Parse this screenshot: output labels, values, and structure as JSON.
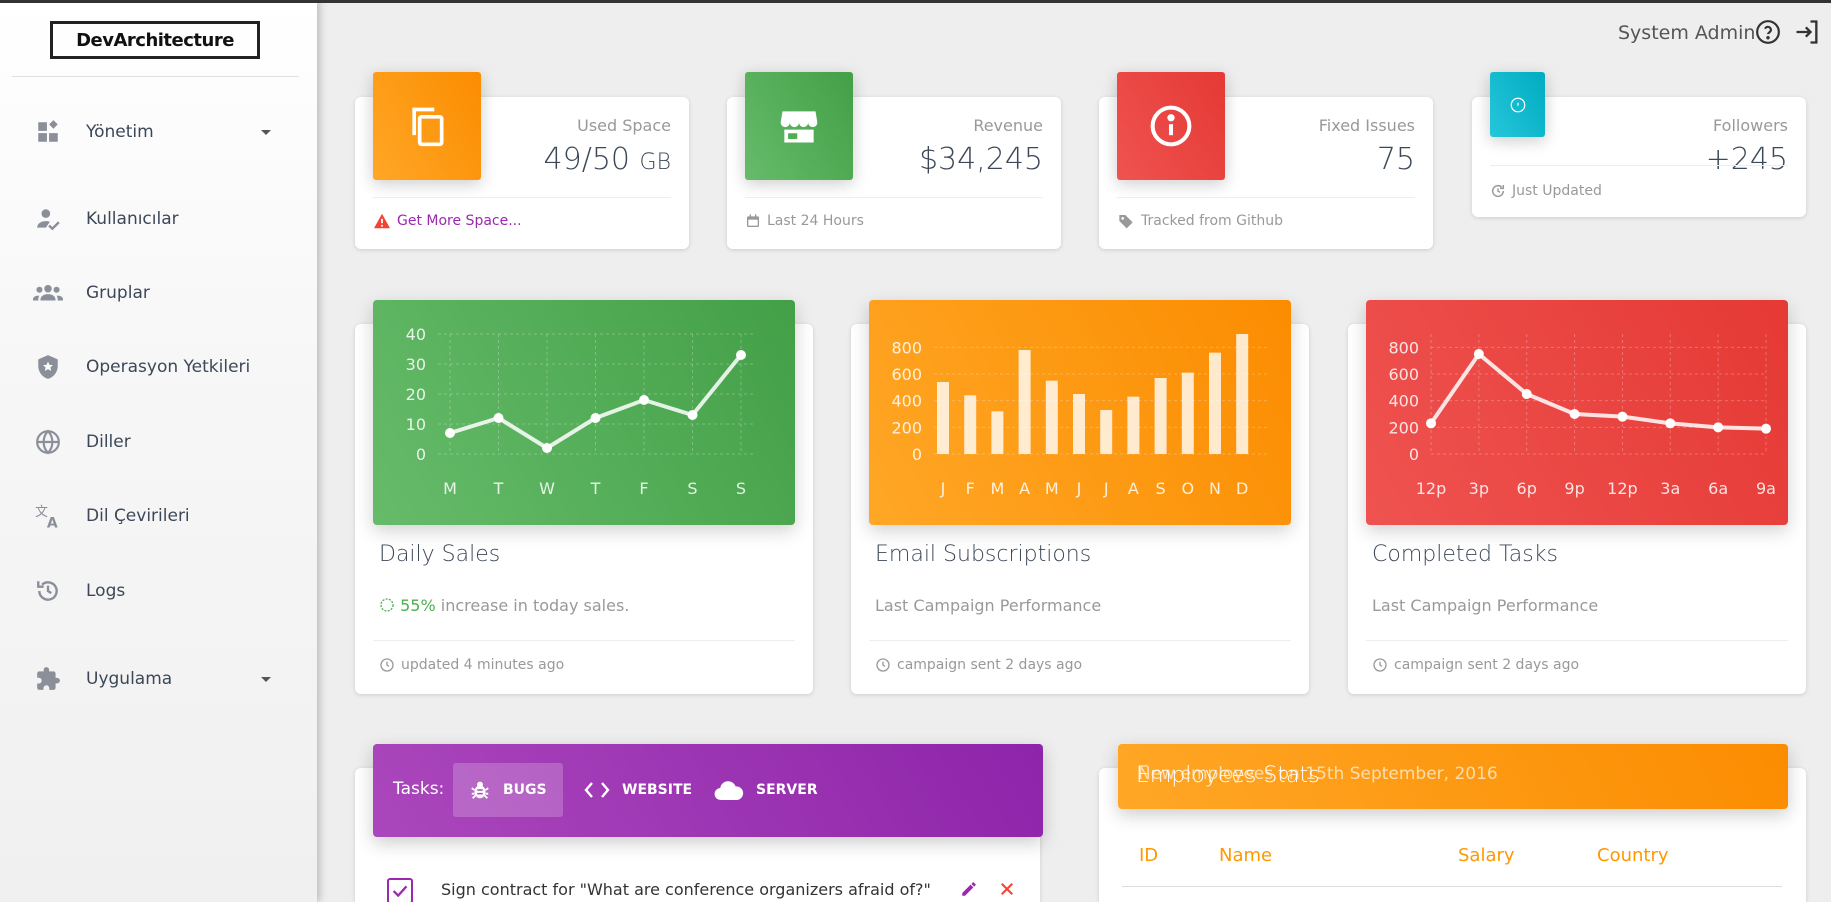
{
  "app": {
    "logo": "DevArchitecture"
  },
  "header": {
    "user_name": "System Admin",
    "help_icon": "help-circle-icon",
    "logout_icon": "logout-icon"
  },
  "sidebar": {
    "items": [
      {
        "label": "Yönetim",
        "icon": "dashboard-icon",
        "has_caret": true
      },
      {
        "label": "Kullanıcılar",
        "icon": "user-check-icon"
      },
      {
        "label": "Gruplar",
        "icon": "group-icon"
      },
      {
        "label": "Operasyon Yetkileri",
        "icon": "shield-star-icon"
      },
      {
        "label": "Diller",
        "icon": "globe-icon"
      },
      {
        "label": "Dil Çevirileri",
        "icon": "translate-icon"
      },
      {
        "label": "Logs",
        "icon": "history-icon"
      },
      {
        "label": "Uygulama",
        "icon": "puzzle-icon",
        "has_caret": true
      }
    ]
  },
  "stats": [
    {
      "category": "Used Space",
      "value": "49/50",
      "unit": "GB",
      "footer": "Get More Space...",
      "icon": "copy-icon",
      "footer_icon": "warning-icon",
      "color": "#fb8c00"
    },
    {
      "category": "Revenue",
      "value": "$34,245",
      "footer": "Last 24 Hours",
      "icon": "store-icon",
      "footer_icon": "calendar-icon",
      "color": "#43a047"
    },
    {
      "category": "Fixed Issues",
      "value": "75",
      "footer": "Tracked from Github",
      "icon": "info-icon",
      "footer_icon": "tag-icon",
      "color": "#e53935"
    },
    {
      "category": "Followers",
      "value": "+245",
      "footer": "Just Updated",
      "icon": "twitter-icon",
      "footer_icon": "update-icon",
      "color": "#00acc1"
    }
  ],
  "charts": [
    {
      "title": "Daily Sales",
      "subtitle_pct": "55%",
      "subtitle_rest": " increase in today sales.",
      "footer": "updated 4 minutes ago",
      "color": "#4caf50"
    },
    {
      "title": "Email Subscriptions",
      "subtitle": "Last Campaign Performance",
      "footer": "campaign sent 2 days ago",
      "color": "#ff9800"
    },
    {
      "title": "Completed Tasks",
      "subtitle": "Last Campaign Performance",
      "footer": "campaign sent 2 days ago",
      "color": "#f44336"
    }
  ],
  "chart_data": [
    {
      "type": "line",
      "categories": [
        "M",
        "T",
        "W",
        "T",
        "F",
        "S",
        "S"
      ],
      "values": [
        7,
        12,
        2,
        12,
        18,
        13,
        33
      ],
      "ylim": [
        0,
        40
      ],
      "y_ticks": [
        0,
        10,
        20,
        30,
        40
      ],
      "grid": true
    },
    {
      "type": "bar",
      "categories": [
        "J",
        "F",
        "M",
        "A",
        "M",
        "J",
        "J",
        "A",
        "S",
        "O",
        "N",
        "D"
      ],
      "values": [
        540,
        440,
        320,
        780,
        550,
        450,
        330,
        430,
        570,
        610,
        760,
        900
      ],
      "ylim": [
        0,
        900
      ],
      "y_ticks": [
        0,
        200,
        400,
        600,
        800
      ],
      "grid": true
    },
    {
      "type": "line",
      "categories": [
        "12p",
        "3p",
        "6p",
        "9p",
        "12p",
        "3a",
        "6a",
        "9a"
      ],
      "values": [
        230,
        750,
        450,
        300,
        280,
        230,
        200,
        190
      ],
      "ylim": [
        0,
        900
      ],
      "y_ticks": [
        0,
        200,
        400,
        600,
        800
      ],
      "grid": true
    }
  ],
  "tasks": {
    "label": "Tasks:",
    "tabs": [
      {
        "label": "BUGS",
        "icon": "bug-icon",
        "active": true
      },
      {
        "label": "WEBSITE",
        "icon": "code-icon"
      },
      {
        "label": "SERVER",
        "icon": "cloud-icon"
      }
    ],
    "items": [
      {
        "text": "Sign contract for \"What are conference organizers afraid of?\"",
        "checked": true
      }
    ]
  },
  "employees": {
    "title": "Employees Stats",
    "subtitle": "New employees on 15th September, 2016",
    "columns": [
      "ID",
      "Name",
      "Salary",
      "Country"
    ]
  }
}
